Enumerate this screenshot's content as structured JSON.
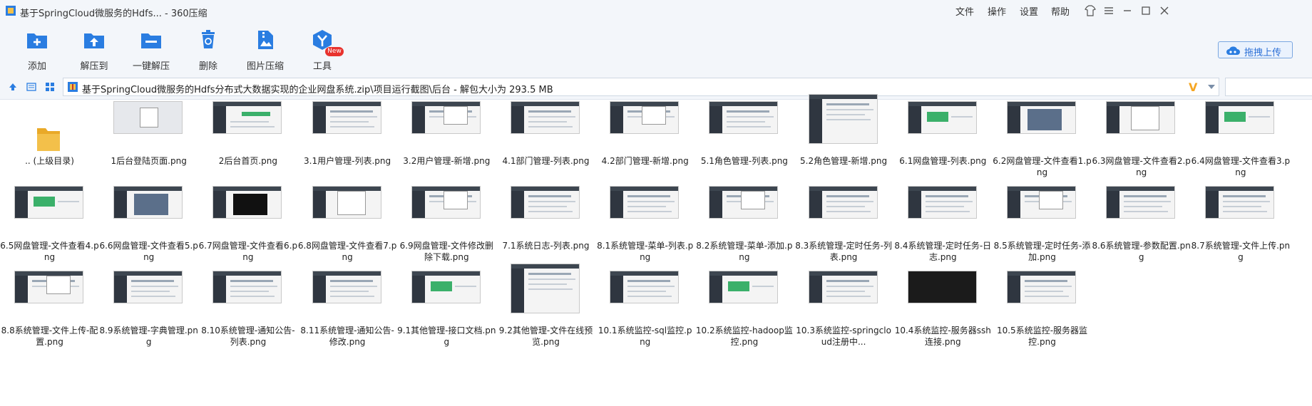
{
  "window": {
    "title": "基于SpringCloud微服务的Hdfs... - 360压缩",
    "menus": [
      "文件",
      "操作",
      "设置",
      "帮助"
    ]
  },
  "toolbar": {
    "tools": [
      {
        "label": "添加",
        "icon": "add-icon"
      },
      {
        "label": "解压到",
        "icon": "extract-to-icon"
      },
      {
        "label": "一键解压",
        "icon": "one-click-extract-icon"
      },
      {
        "label": "删除",
        "icon": "delete-icon"
      },
      {
        "label": "图片压缩",
        "icon": "image-compress-icon"
      },
      {
        "label": "工具",
        "icon": "tools-icon"
      }
    ],
    "new_badge": "New",
    "upload_label": "拖拽上传"
  },
  "address": {
    "path": "基于SpringCloud微服务的Hdfs分布式大数据实现的企业网盘系统.zip\\项目运行截图\\后台 - 解包大小为 293.5 MB",
    "v_mark": "V"
  },
  "files": [
    {
      "name": ".. (上级目录)",
      "kind": "folder"
    },
    {
      "name": "1后台登陆页面.png",
      "kind": "login"
    },
    {
      "name": "2后台首页.png",
      "kind": "home"
    },
    {
      "name": "3.1用户管理-列表.png",
      "kind": "list"
    },
    {
      "name": "3.2用户管理-新增.png",
      "kind": "dialog"
    },
    {
      "name": "4.1部门管理-列表.png",
      "kind": "list"
    },
    {
      "name": "4.2部门管理-新增.png",
      "kind": "dialog"
    },
    {
      "name": "5.1角色管理-列表.png",
      "kind": "list"
    },
    {
      "name": "5.2角色管理-新增.png",
      "kind": "tall"
    },
    {
      "name": "6.1网盘管理-列表.png",
      "kind": "green"
    },
    {
      "name": "6.2网盘管理-文件查看1.png",
      "kind": "photo"
    },
    {
      "name": "6.3网盘管理-文件查看2.png",
      "kind": "doc"
    },
    {
      "name": "6.4网盘管理-文件查看3.png",
      "kind": "green"
    },
    {
      "name": "6.5网盘管理-文件查看4.png",
      "kind": "green"
    },
    {
      "name": "6.6网盘管理-文件查看5.png",
      "kind": "photo"
    },
    {
      "name": "6.7网盘管理-文件查看6.png",
      "kind": "video"
    },
    {
      "name": "6.8网盘管理-文件查看7.png",
      "kind": "doc"
    },
    {
      "name": "6.9网盘管理-文件修改删除下载.png",
      "kind": "dialog"
    },
    {
      "name": "7.1系统日志-列表.png",
      "kind": "list"
    },
    {
      "name": "8.1系统管理-菜单-列表.png",
      "kind": "list"
    },
    {
      "name": "8.2系统管理-菜单-添加.png",
      "kind": "dialog"
    },
    {
      "name": "8.3系统管理-定时任务-列表.png",
      "kind": "list"
    },
    {
      "name": "8.4系统管理-定时任务-日志.png",
      "kind": "list"
    },
    {
      "name": "8.5系统管理-定时任务-添加.png",
      "kind": "dialog"
    },
    {
      "name": "8.6系统管理-参数配置.png",
      "kind": "list"
    },
    {
      "name": "8.7系统管理-文件上传.png",
      "kind": "list"
    },
    {
      "name": "8.8系统管理-文件上传-配置.png",
      "kind": "dialog"
    },
    {
      "name": "8.9系统管理-字典管理.png",
      "kind": "list"
    },
    {
      "name": "8.10系统管理-通知公告-列表.png",
      "kind": "list"
    },
    {
      "name": "8.11系统管理-通知公告-修改.png",
      "kind": "list"
    },
    {
      "name": "9.1其他管理-接口文档.png",
      "kind": "green"
    },
    {
      "name": "9.2其他管理-文件在线预览.png",
      "kind": "tall"
    },
    {
      "name": "10.1系统监控-sql监控.png",
      "kind": "list"
    },
    {
      "name": "10.2系统监控-hadoop监控.png",
      "kind": "green"
    },
    {
      "name": "10.3系统监控-springcloud注册中...",
      "kind": "list"
    },
    {
      "name": "10.4系统监控-服务器ssh连接.png",
      "kind": "terminal"
    },
    {
      "name": "10.5系统监控-服务器监控.png",
      "kind": "list"
    }
  ],
  "colors": {
    "chrome_bg": "#f3f6fa",
    "accent_blue": "#2a7de1",
    "badge_red": "#e8322d",
    "folder_yellow": "#f3c04a"
  }
}
